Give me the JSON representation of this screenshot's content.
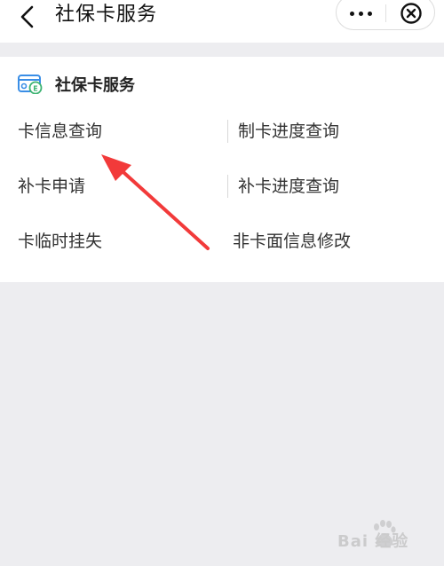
{
  "nav": {
    "title": "社保卡服务",
    "back_icon": "chevron-left-icon",
    "more_icon": "more-dots-icon",
    "close_icon": "close-circle-icon"
  },
  "card": {
    "title": "社保卡服务",
    "icon": "social-security-card-icon",
    "items": [
      {
        "label": "卡信息查询"
      },
      {
        "label": "制卡进度查询"
      },
      {
        "label": "补卡申请"
      },
      {
        "label": "补卡进度查询"
      },
      {
        "label": "卡临时挂失"
      },
      {
        "label": "非卡面信息修改"
      }
    ]
  },
  "annotation": {
    "arrow_color": "#f23a3a"
  },
  "watermark": {
    "text": "Bai 经验",
    "icon": "baidu-paw-icon"
  },
  "colors": {
    "background": "#ededf0",
    "surface": "#ffffff",
    "card_icon_blue": "#3a8ee6",
    "card_icon_green": "#3cb371"
  }
}
